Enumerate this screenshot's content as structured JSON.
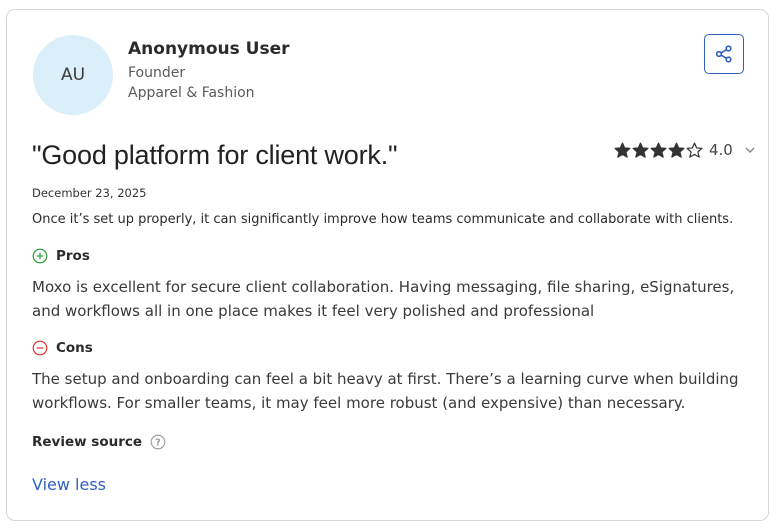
{
  "reviewer": {
    "initials": "AU",
    "name": "Anonymous User",
    "role": "Founder",
    "industry": "Apparel & Fashion"
  },
  "review": {
    "title": "\"Good platform for client work.\"",
    "rating": 4,
    "rating_max": 5,
    "rating_label": "4.0",
    "date": "December 23, 2025",
    "summary": "Once it’s set up properly, it can significantly improve how teams communicate and collaborate with clients.",
    "pros_label": "Pros",
    "pros_text": "Moxo is excellent for secure client collaboration. Having messaging, file sharing, eSignatures, and workflows all in one place makes it feel very polished and professional",
    "cons_label": "Cons",
    "cons_text": "The setup and onboarding can feel a bit heavy at first. There’s a learning curve when building workflows. For smaller teams, it may feel more robust (and expensive) than necessary.",
    "source_label": "Review source",
    "view_less_label": "View less"
  },
  "icons": {
    "share": "share-icon",
    "pros": "plus-circle-icon",
    "cons": "minus-circle-icon",
    "help": "question-circle-icon",
    "expand": "chevron-down-icon"
  },
  "colors": {
    "accent": "#2f62c0",
    "pros_green": "#2e9b3b",
    "cons_red": "#d9342b",
    "avatar_bg": "#dbeffa",
    "star": "#333333"
  }
}
